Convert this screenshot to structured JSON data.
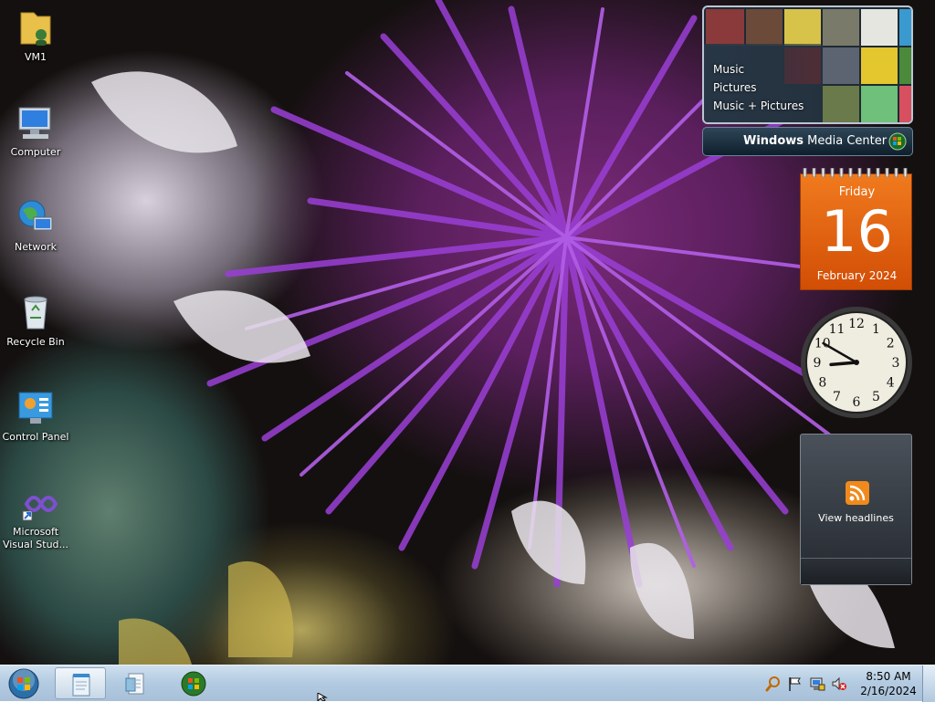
{
  "desktop": {
    "icons": [
      {
        "label": "VM1",
        "icon": "user-folder-icon"
      },
      {
        "label": "Computer",
        "icon": "computer-icon"
      },
      {
        "label": "Network",
        "icon": "network-globe-icon"
      },
      {
        "label": "Recycle Bin",
        "icon": "recycle-bin-icon"
      },
      {
        "label": "Control Panel",
        "icon": "control-panel-icon"
      },
      {
        "label": "Microsoft Visual Stud...",
        "icon": "visual-studio-icon"
      }
    ]
  },
  "gadgets": {
    "media_center": {
      "menu": [
        "Music",
        "Pictures",
        "Music + Pictures"
      ],
      "brand_bold": "Windows",
      "brand_light": " Media Center"
    },
    "calendar": {
      "weekday": "Friday",
      "day": "16",
      "month_year": "February 2024"
    },
    "clock": {
      "time": "8:50",
      "numerals": [
        "12",
        "1",
        "2",
        "3",
        "4",
        "5",
        "6",
        "7",
        "8",
        "9",
        "10",
        "11"
      ]
    },
    "feed": {
      "label": "View headlines",
      "icon": "rss-icon"
    }
  },
  "taskbar": {
    "start_icon": "windows-start-orb-icon",
    "pinned": [
      {
        "icon": "notepad-icon",
        "active": true
      },
      {
        "icon": "document-explorer-icon",
        "active": false
      },
      {
        "icon": "media-center-icon",
        "active": false
      }
    ],
    "tray": {
      "icons": [
        "search-icon",
        "action-center-flag-icon",
        "network-icon",
        "volume-muted-icon"
      ],
      "time": "8:50 AM",
      "date": "2/16/2024"
    }
  },
  "colors": {
    "calendar_orange": "#e0640f",
    "taskbar_blue": "#b4cce2",
    "feed_dark": "#2c3137"
  }
}
